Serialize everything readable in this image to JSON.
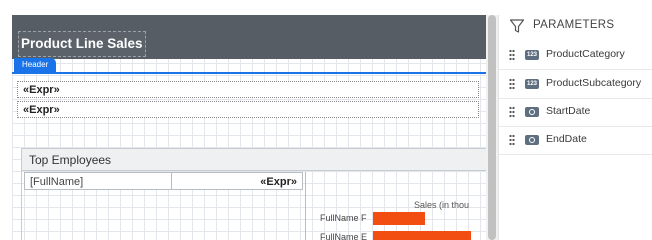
{
  "report": {
    "title": "Product Line Sales",
    "band_tab": "Header",
    "expr_fields": [
      "«Expr»",
      "«Expr»"
    ],
    "panel": {
      "title": "Top Employees",
      "name_cell": "[FullName]",
      "expr_cell": "«Expr»"
    },
    "chart": {
      "title": "Sales (in thou",
      "bar_color": "#f24e11"
    }
  },
  "chart_data": {
    "type": "bar",
    "orientation": "horizontal",
    "title": "Sales (in thou",
    "categories": [
      "FullName F",
      "FullName E"
    ],
    "values": [
      55,
      105
    ],
    "xlim": [
      0,
      110
    ]
  },
  "parameters": {
    "title": "PARAMETERS",
    "items": [
      {
        "label": "ProductCategory",
        "type": "123",
        "icon": "number-type-icon"
      },
      {
        "label": "ProductSubcategory",
        "type": "123",
        "icon": "number-type-icon"
      },
      {
        "label": "StartDate",
        "type": "",
        "icon": "date-type-icon"
      },
      {
        "label": "EndDate",
        "type": "",
        "icon": "date-type-icon"
      }
    ]
  },
  "colors": {
    "accent": "#1a73e8",
    "header_bg": "#565d65",
    "bar": "#f24e11"
  }
}
